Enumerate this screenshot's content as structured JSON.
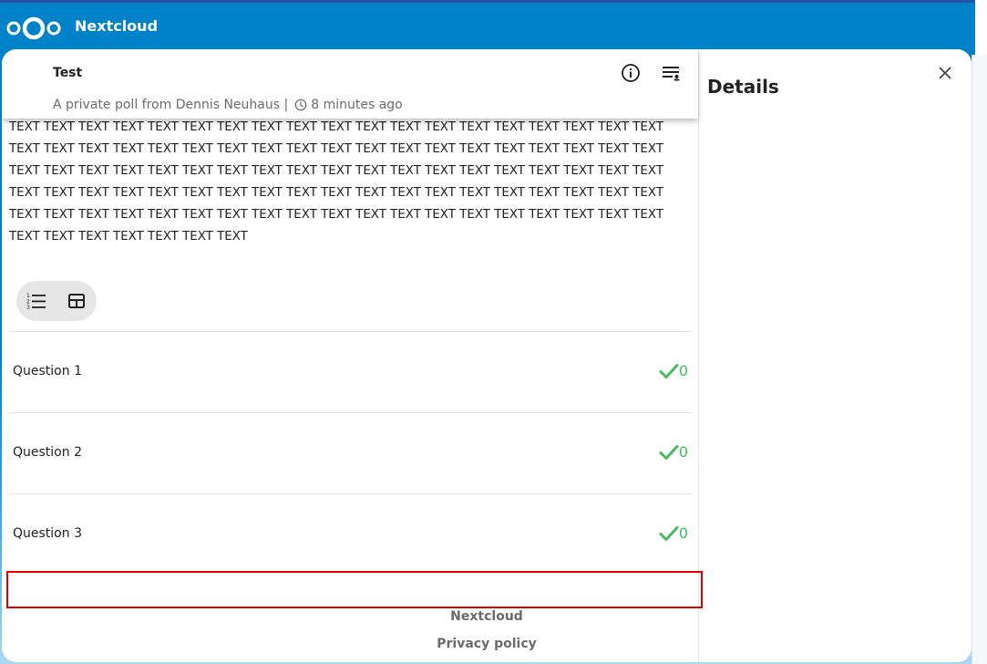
{
  "app": {
    "name": "Nextcloud"
  },
  "poll": {
    "title": "Test",
    "subtitle": "A private poll from Dennis Neuhaus |",
    "age": "8 minutes ago",
    "description": "TEXT TEXT TEXT TEXT TEXT TEXT TEXT TEXT TEXT TEXT TEXT TEXT TEXT TEXT TEXT TEXT TEXT TEXT TEXT TEXT TEXT TEXT TEXT TEXT TEXT TEXT TEXT TEXT TEXT TEXT TEXT TEXT TEXT TEXT TEXT TEXT TEXT TEXT TEXT TEXT TEXT TEXT TEXT TEXT TEXT TEXT TEXT TEXT TEXT TEXT TEXT TEXT TEXT TEXT TEXT TEXT TEXT TEXT TEXT TEXT TEXT TEXT TEXT TEXT TEXT TEXT TEXT TEXT TEXT TEXT TEXT TEXT TEXT TEXT TEXT TEXT TEXT TEXT TEXT TEXT TEXT TEXT TEXT TEXT TEXT TEXT TEXT TEXT TEXT TEXT TEXT TEXT TEXT TEXT TEXT TEXT TEXT TEXT TEXT TEXT TEXT TEXT"
  },
  "icons": {
    "info": "info-icon",
    "filter": "filter-icon",
    "list": "list-view-icon",
    "table": "table-view-icon",
    "clock": "clock-icon",
    "check": "check-icon",
    "close": "close-icon"
  },
  "options": [
    {
      "label": "Question 1",
      "count": "0"
    },
    {
      "label": "Question 2",
      "count": "0"
    },
    {
      "label": "Question 3",
      "count": "0"
    }
  ],
  "sidebar": {
    "title": "Details"
  },
  "footer": {
    "name": "Nextcloud",
    "privacy": "Privacy policy"
  },
  "colors": {
    "brand": "#0082c9",
    "yes": "#46ba61",
    "highlight": "#e00000"
  }
}
